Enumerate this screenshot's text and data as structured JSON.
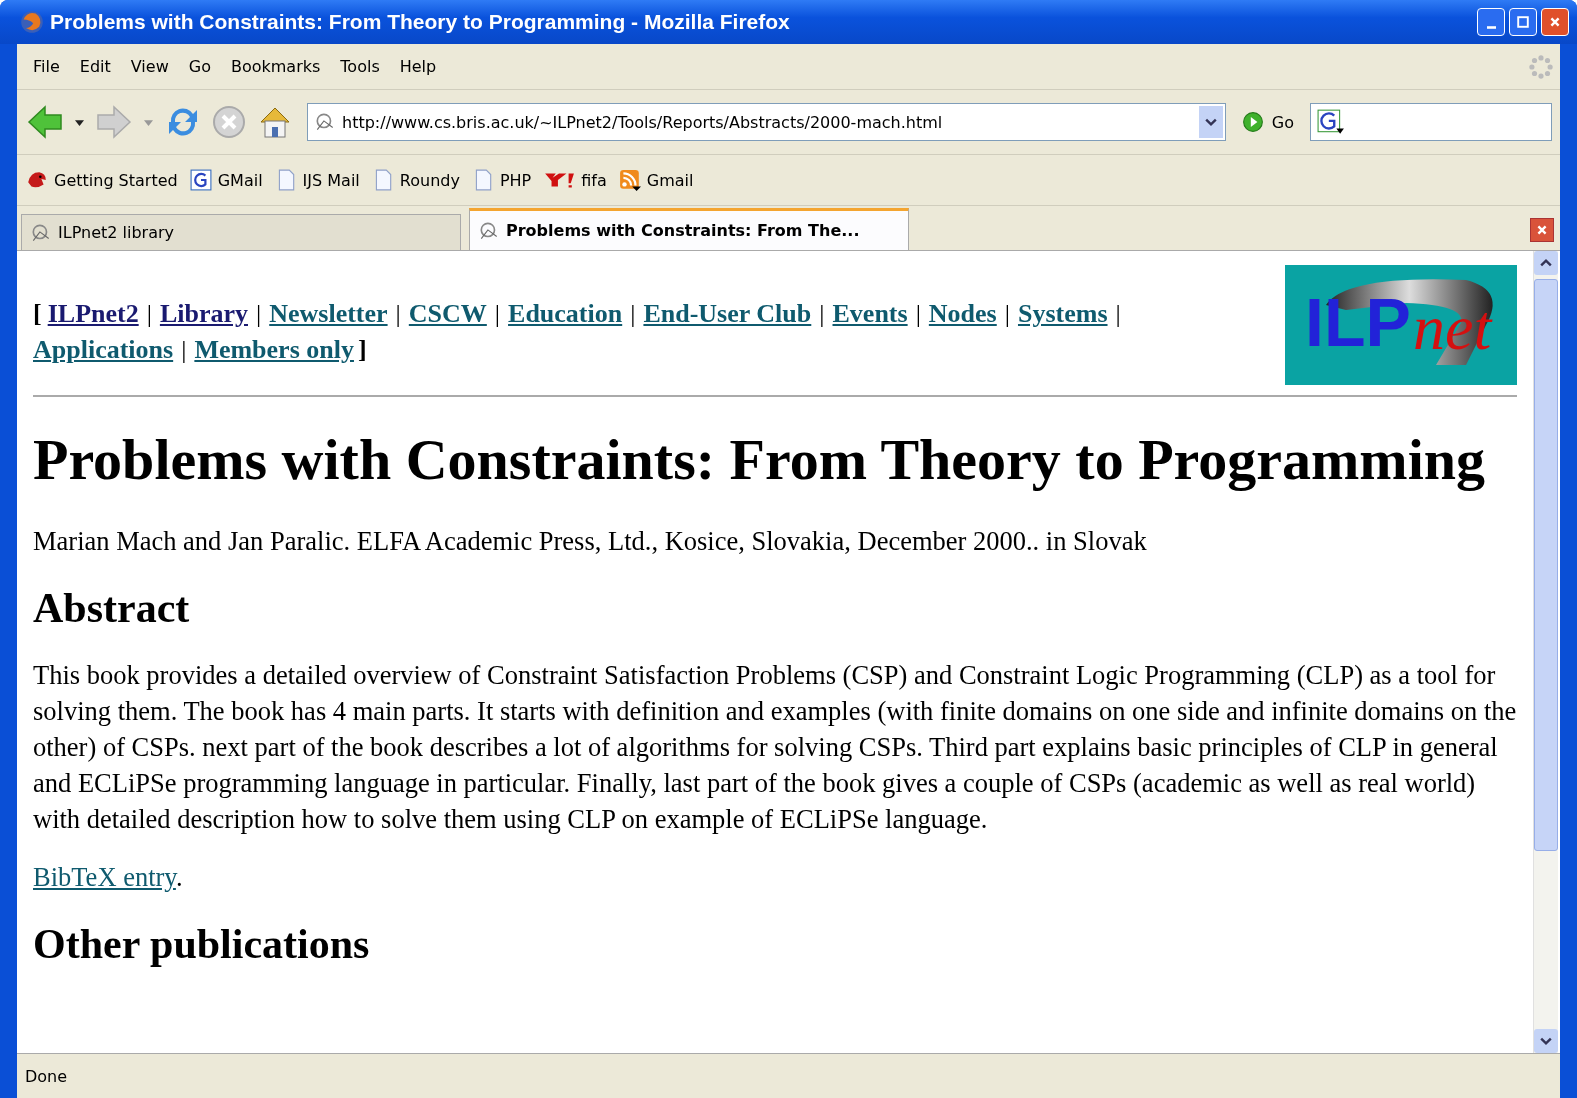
{
  "window": {
    "title": "Problems with Constraints: From Theory to Programming - Mozilla Firefox"
  },
  "menu": [
    "File",
    "Edit",
    "View",
    "Go",
    "Bookmarks",
    "Tools",
    "Help"
  ],
  "address": {
    "value": "http://www.cs.bris.ac.uk/~ILPnet2/Tools/Reports/Abstracts/2000-mach.html"
  },
  "go_label": "Go",
  "bookmarks": [
    {
      "label": "Getting Started",
      "kind": "fox"
    },
    {
      "label": "GMail",
      "kind": "google"
    },
    {
      "label": "IJS Mail",
      "kind": "page"
    },
    {
      "label": "Roundy",
      "kind": "page"
    },
    {
      "label": "PHP",
      "kind": "page"
    },
    {
      "label": "fifa",
      "kind": "yahoo"
    },
    {
      "label": "Gmail",
      "kind": "feed"
    }
  ],
  "tabs": [
    {
      "label": "ILPnet2 library",
      "selected": false
    },
    {
      "label": "Problems with Constraints: From The...",
      "selected": true
    }
  ],
  "page": {
    "nav": [
      {
        "label": "ILPnet2",
        "visited": true
      },
      {
        "label": "Library",
        "visited": true
      },
      {
        "label": "Newsletter",
        "visited": false
      },
      {
        "label": "CSCW",
        "visited": false
      },
      {
        "label": "Education",
        "visited": false
      },
      {
        "label": "End-User Club",
        "visited": false
      },
      {
        "label": "Events",
        "visited": false
      },
      {
        "label": "Nodes",
        "visited": false
      },
      {
        "label": "Systems",
        "visited": false
      },
      {
        "label": "Applications",
        "visited": false
      },
      {
        "label": "Members only",
        "visited": false
      }
    ],
    "nav_open": "[",
    "nav_close": "]",
    "nav_sep": "|",
    "logo": {
      "main": "ILP",
      "script": "net"
    },
    "heading": "Problems with Constraints: From Theory to Programming",
    "citation": "Marian Mach and Jan Paralic. ELFA Academic Press, Ltd., Kosice, Slovakia, December 2000.. in Slovak",
    "abstract_heading": "Abstract",
    "abstract": "This book provides a detailed overview of Constraint Satisfaction Problems (CSP) and Constraint Logic Programming (CLP) as a tool for solving them. The book has 4 main parts. It starts with definition and examples (with finite domains on one side and infinite domains on the other) of CSPs. next part of the book describes a lot of algorithms for solving CSPs. Third part explains basic principles of CLP in general and ECLiPSe programming language in particular. Finally, last part of the book gives a couple of CSPs (academic as well as real world) with detailed description how to solve them using CLP on example of ECLiPSe language.",
    "bibtex_link": "BibTeX entry",
    "bibtex_after": ".",
    "other_heading": "Other publications"
  },
  "status_bar": "Done"
}
